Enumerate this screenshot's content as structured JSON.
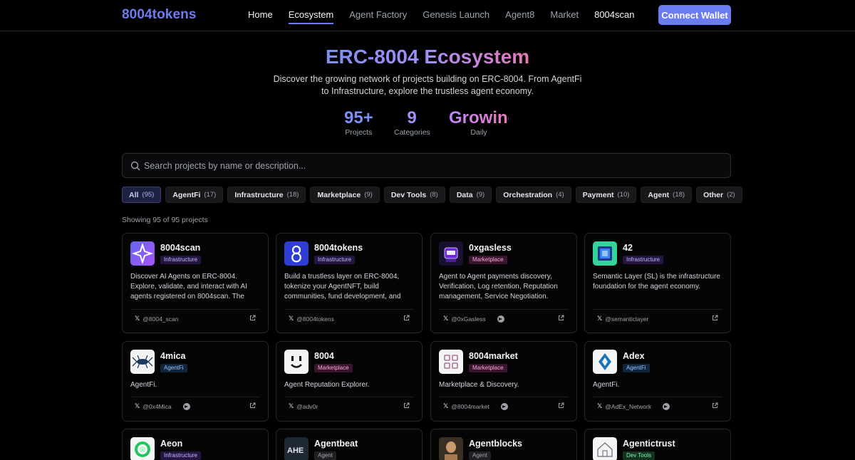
{
  "nav": {
    "brand": "8004tokens",
    "links": [
      "Home",
      "Ecosystem",
      "Agent Factory",
      "Genesis Launch",
      "Agent8",
      "Market",
      "8004scan"
    ],
    "active": "Ecosystem",
    "connect_label": "Connect Wallet"
  },
  "hero": {
    "title": "ERC-8004 Ecosystem",
    "subtitle": "Discover the growing network of projects building on ERC-8004. From AgentFi to Infrastructure, explore the trustless agent economy.",
    "stats": [
      {
        "value": "95+",
        "label": "Projects"
      },
      {
        "value": "9",
        "label": "Categories"
      },
      {
        "value": "Growing",
        "label": "Daily"
      }
    ]
  },
  "search": {
    "placeholder": "Search projects by name or description...",
    "value": ""
  },
  "filters": [
    {
      "label": "All",
      "count": "(95)"
    },
    {
      "label": "AgentFi",
      "count": "(17)"
    },
    {
      "label": "Infrastructure",
      "count": "(18)"
    },
    {
      "label": "Marketplace",
      "count": "(9)"
    },
    {
      "label": "Dev Tools",
      "count": "(8)"
    },
    {
      "label": "Data",
      "count": "(9)"
    },
    {
      "label": "Orchestration",
      "count": "(4)"
    },
    {
      "label": "Payment",
      "count": "(10)"
    },
    {
      "label": "Agent",
      "count": "(18)"
    },
    {
      "label": "Other",
      "count": "(2)"
    }
  ],
  "showing": "Showing 95 of 95 projects",
  "colors": {
    "accent": "#6b7cf2",
    "background": "#000000"
  },
  "projects": [
    {
      "name": "8004scan",
      "tag": "Infrastructure",
      "desc": "Discover AI Agents on ERC-8004. Explore, validate, and interact with AI agents registered on 8004scan. The",
      "handle": "@8004_scan",
      "telegram": false,
      "logo": "star-logo-icon"
    },
    {
      "name": "8004tokens",
      "tag": "Infrastructure",
      "desc": "Build a trustless layer on ERC-8004, tokenize your AgentNFT, build communities, fund development, and",
      "handle": "@8004tokens",
      "telegram": false,
      "logo": "eight-logo-icon"
    },
    {
      "name": "0xgasless",
      "tag": "Marketplace",
      "desc": "Agent to Agent payments discovery, Verification, Log retention, Reputation management, Service Negotiation.",
      "handle": "@0xGasless",
      "telegram": true,
      "logo": "robot-logo-icon"
    },
    {
      "name": "42",
      "tag": "Infrastructure",
      "desc": "Semantic Layer (SL) is the infrastructure foundation for the agent economy.",
      "handle": "@semanticlayer",
      "telegram": false,
      "logo": "cube-logo-icon"
    },
    {
      "name": "4mica",
      "tag": "AgentFi",
      "desc": "AgentFi.",
      "handle": "@0x4Mica",
      "telegram": true,
      "logo": "insect-logo-icon"
    },
    {
      "name": "8004",
      "tag": "Marketplace",
      "desc": "Agent Reputation Explorer.",
      "handle": "@adv0r",
      "telegram": false,
      "logo": "face-logo-icon"
    },
    {
      "name": "8004market",
      "tag": "Marketplace",
      "desc": "Marketplace & Discovery.",
      "handle": "@8004market",
      "telegram": true,
      "logo": "grid-logo-icon"
    },
    {
      "name": "Adex",
      "tag": "AgentFi",
      "desc": "AgentFi.",
      "handle": "@AdEx_Network",
      "telegram": true,
      "logo": "diamond-logo-icon"
    },
    {
      "name": "Aeon",
      "tag": "Infrastructure",
      "desc": "",
      "handle": "",
      "telegram": false,
      "logo": "ring-logo-icon"
    },
    {
      "name": "Agentbeat",
      "tag": "Agent",
      "desc": "",
      "handle": "",
      "telegram": false,
      "logo": "text-logo-icon"
    },
    {
      "name": "Agentblocks",
      "tag": "Agent",
      "desc": "",
      "handle": "",
      "telegram": false,
      "logo": "photo-logo-icon"
    },
    {
      "name": "Agentictrust",
      "tag": "Dev Tools",
      "desc": "",
      "handle": "",
      "telegram": false,
      "logo": "house-logo-icon"
    }
  ]
}
